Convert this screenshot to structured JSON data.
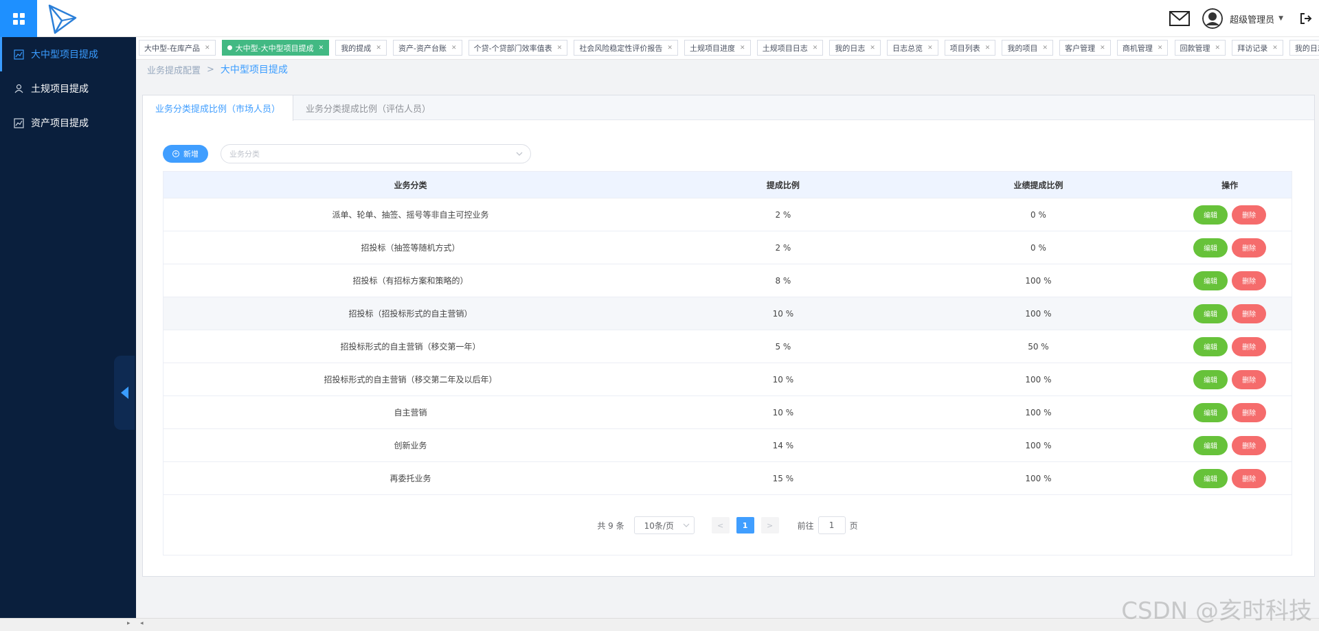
{
  "header": {
    "username": "超级管理员",
    "icons": {
      "menu": "grid-menu-icon",
      "logo": "paper-plane-logo",
      "mail": "mail-icon",
      "avatar": "user-avatar-icon",
      "logout": "logout-icon"
    },
    "accent": "#1e90ff"
  },
  "sidebar": {
    "items": [
      {
        "label": "大中型项目提成",
        "icon": "chart-icon",
        "active": true
      },
      {
        "label": "土规项目提成",
        "icon": "users-icon",
        "active": false
      },
      {
        "label": "资产项目提成",
        "icon": "chart-icon",
        "active": false
      }
    ],
    "bg": "#0a1f3d"
  },
  "tags": [
    {
      "label": "大中型-在库产品",
      "active": false
    },
    {
      "label": "大中型-大中型项目提成",
      "active": true
    },
    {
      "label": "我的提成",
      "active": false
    },
    {
      "label": "资产-资产台账",
      "active": false
    },
    {
      "label": "个贷-个贷部门效率值表",
      "active": false
    },
    {
      "label": "社会风险稳定性评价报告",
      "active": false
    },
    {
      "label": "土规项目进度",
      "active": false
    },
    {
      "label": "土规项目日志",
      "active": false
    },
    {
      "label": "我的日志",
      "active": false
    },
    {
      "label": "日志总览",
      "active": false
    },
    {
      "label": "项目列表",
      "active": false
    },
    {
      "label": "我的项目",
      "active": false
    },
    {
      "label": "客户管理",
      "active": false
    },
    {
      "label": "商机管理",
      "active": false
    },
    {
      "label": "回款管理",
      "active": false
    },
    {
      "label": "拜访记录",
      "active": false
    },
    {
      "label": "我的日志",
      "active": false
    }
  ],
  "breadcrumb": {
    "parent": "业务提成配置",
    "separator": ">",
    "current": "大中型项目提成"
  },
  "tabs": [
    {
      "label": "业务分类提成比例（市场人员）",
      "active": true
    },
    {
      "label": "业务分类提成比例（评估人员）",
      "active": false
    }
  ],
  "toolbar": {
    "add_label": "新增",
    "select_placeholder": "业务分类"
  },
  "table": {
    "headers": [
      "业务分类",
      "提成比例",
      "业绩提成比例",
      "操作"
    ],
    "edit_label": "编辑",
    "delete_label": "删除",
    "rows": [
      {
        "category": "派单、轮单、抽签、摇号等非自主可控业务",
        "rate": "2 %",
        "perf_rate": "0 %"
      },
      {
        "category": "招投标（抽签等随机方式）",
        "rate": "2 %",
        "perf_rate": "0 %"
      },
      {
        "category": "招投标（有招标方案和策略的）",
        "rate": "8 %",
        "perf_rate": "100 %"
      },
      {
        "category": "招投标（招投标形式的自主营销）",
        "rate": "10 %",
        "perf_rate": "100 %"
      },
      {
        "category": "招投标形式的自主营销（移交第一年）",
        "rate": "5 %",
        "perf_rate": "50 %"
      },
      {
        "category": "招投标形式的自主营销（移交第二年及以后年）",
        "rate": "10 %",
        "perf_rate": "100 %"
      },
      {
        "category": "自主营销",
        "rate": "10 %",
        "perf_rate": "100 %"
      },
      {
        "category": "创新业务",
        "rate": "14 %",
        "perf_rate": "100 %"
      },
      {
        "category": "再委托业务",
        "rate": "15 %",
        "perf_rate": "100 %"
      }
    ]
  },
  "pagination": {
    "total_text": "共 9 条",
    "page_size": "10条/页",
    "prev": "<",
    "current_page": "1",
    "next": ">",
    "goto_label": "前往",
    "goto_value": "1",
    "page_suffix": "页"
  },
  "watermark": "CSDN @亥时科技",
  "bottombar": {
    "left_arrow": "▸",
    "right_arrow": "◂"
  }
}
